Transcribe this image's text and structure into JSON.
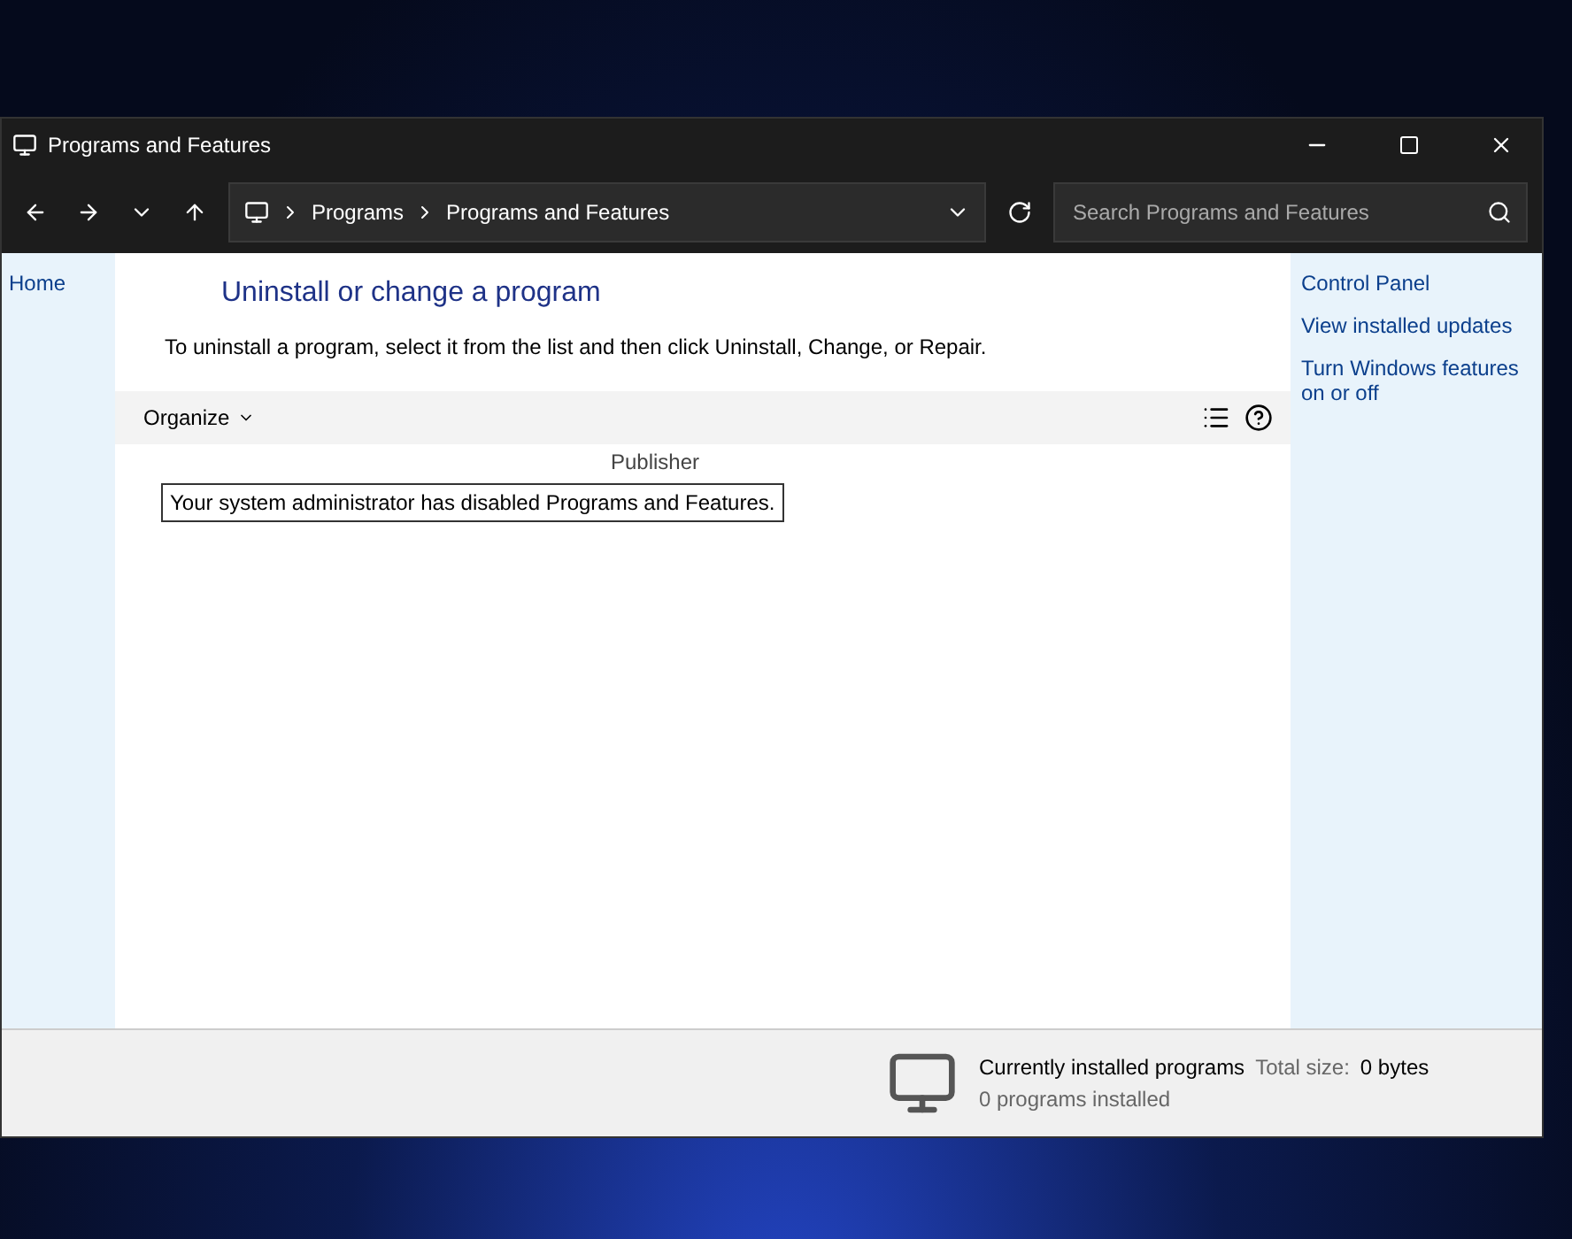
{
  "window": {
    "title": "Programs and Features"
  },
  "address_bar": {
    "breadcrumbs": [
      "Programs",
      "Programs and Features"
    ]
  },
  "search": {
    "placeholder": "Search Programs and Features"
  },
  "left_panel": {
    "items": [
      "Home"
    ]
  },
  "content": {
    "heading": "Uninstall or change a program",
    "description": "To uninstall a program, select it from the list and then click Uninstall, Change, or Repair.",
    "toolbar": {
      "organize": "Organize"
    },
    "columns": [
      "Publisher"
    ],
    "message": "Your system administrator has disabled Programs and Features."
  },
  "right_panel": {
    "links": [
      "Control Panel",
      "View installed updates",
      "Turn Windows features on or off"
    ]
  },
  "details": {
    "title": "Currently installed programs",
    "size_label": "Total size:",
    "size": "0 bytes",
    "count": "0 programs installed"
  }
}
